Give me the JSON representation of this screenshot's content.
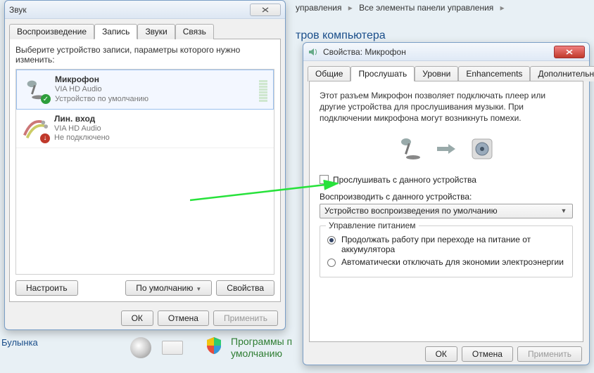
{
  "breadcrumb": {
    "seg1": "управления",
    "seg2": "Все элементы панели управления"
  },
  "bg": {
    "heading": "тров компьютера",
    "user": "Булынка",
    "prog1": "Программы п",
    "prog2": "умолчанию"
  },
  "sound_window": {
    "title": "Звук",
    "tabs": {
      "playback": "Воспроизведение",
      "recording": "Запись",
      "sounds": "Звуки",
      "comm": "Связь"
    },
    "hint": "Выберите устройство записи, параметры которого нужно изменить:",
    "devices": [
      {
        "name": "Микрофон",
        "driver": "VIA HD Audio",
        "status": "Устройство по умолчанию",
        "badge": "ok"
      },
      {
        "name": "Лин. вход",
        "driver": "VIA HD Audio",
        "status": "Не подключено",
        "badge": "down"
      }
    ],
    "buttons": {
      "configure": "Настроить",
      "default": "По умолчанию",
      "properties": "Свойства"
    },
    "footer": {
      "ok": "ОК",
      "cancel": "Отмена",
      "apply": "Применить"
    }
  },
  "prop_window": {
    "title": "Свойства: Микрофон",
    "tabs": {
      "general": "Общие",
      "listen": "Прослушать",
      "levels": "Уровни",
      "enh": "Enhancements",
      "adv": "Дополнительно"
    },
    "info": "Этот разъем Микрофон позволяет подключать плеер или другие устройства для прослушивания музыки. При подключении микрофона могут возникнуть помехи.",
    "listen_chk": "Прослушивать с данного устройства",
    "playback_label": "Воспроизводить с данного устройства:",
    "playback_combo": "Устройство воспроизведения по умолчанию",
    "power_group": "Управление питанием",
    "power_opt1": "Продолжать работу при переходе на питание от аккумулятора",
    "power_opt2": "Автоматически отключать для экономии электроэнергии",
    "footer": {
      "ok": "ОК",
      "cancel": "Отмена",
      "apply": "Применить"
    }
  }
}
